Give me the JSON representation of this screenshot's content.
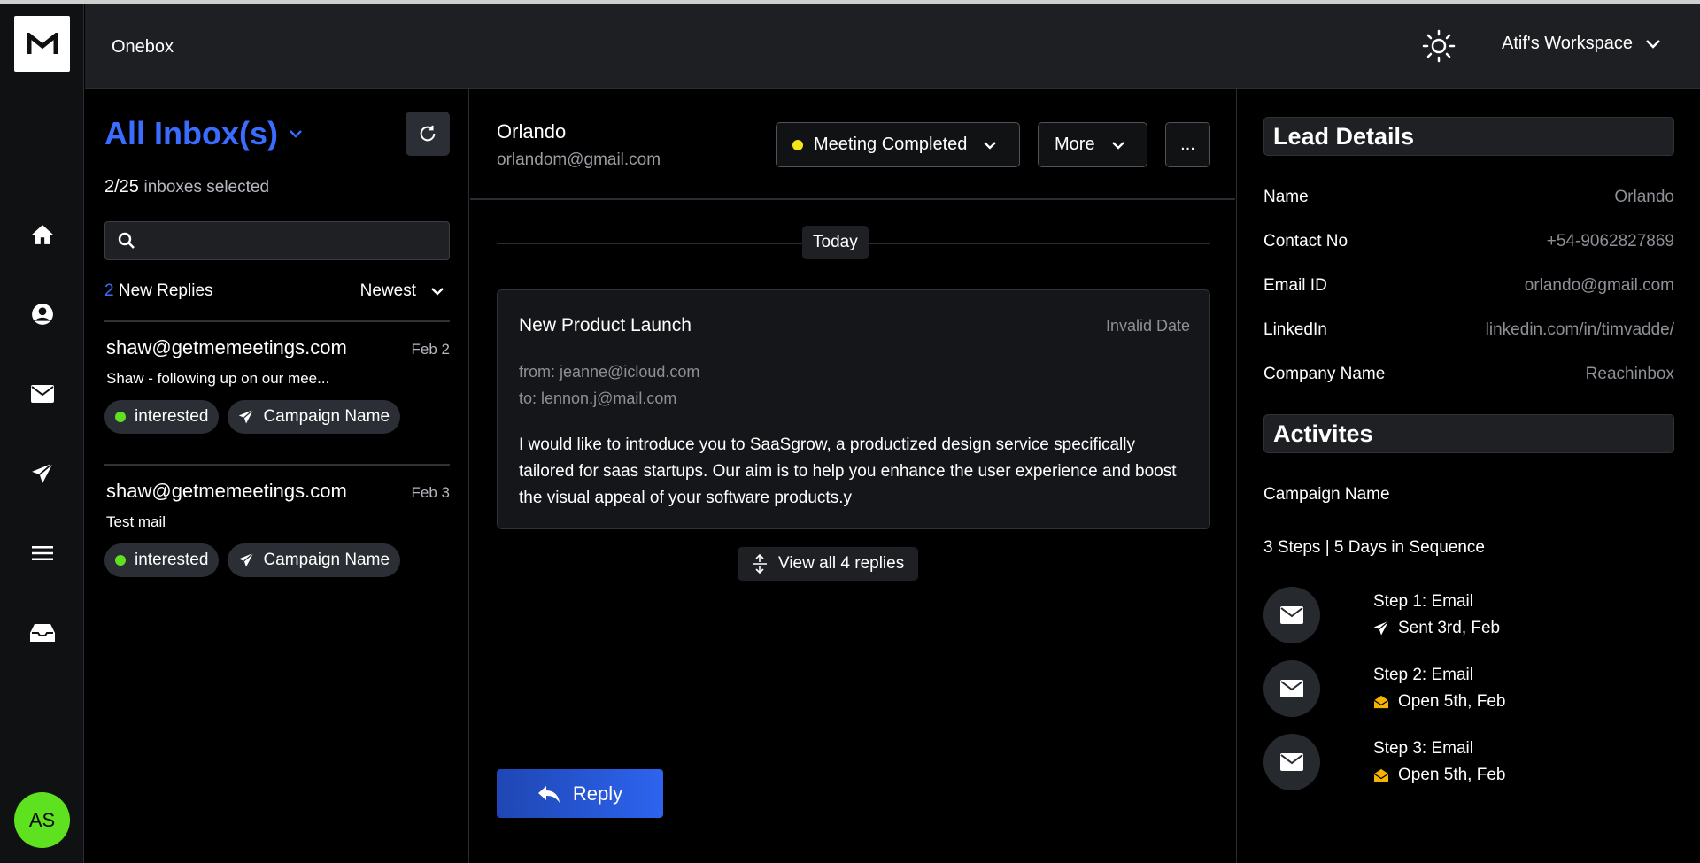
{
  "header": {
    "app_title": "Onebox",
    "workspace": "Atif's Workspace"
  },
  "rail": {
    "avatar_initials": "AS",
    "icons": [
      "home-icon",
      "profile-icon",
      "mail-icon",
      "send-icon",
      "list-icon",
      "inbox-tray-icon"
    ]
  },
  "inbox": {
    "title": "All Inbox(s)",
    "selected_count": "2/25",
    "selected_label": "inboxes selected",
    "search_placeholder": "",
    "new_replies_count": "2",
    "new_replies_label": "New Replies",
    "sort_label": "Newest",
    "threads": [
      {
        "email": "shaw@getmemeetings.com",
        "date": "Feb 2",
        "snippet": "Shaw - following up on our mee...",
        "status": "interested",
        "campaign": "Campaign Name"
      },
      {
        "email": "shaw@getmemeetings.com",
        "date": "Feb 3",
        "snippet": "Test mail",
        "status": "interested",
        "campaign": "Campaign Name"
      }
    ]
  },
  "conversation": {
    "lead_name": "Orlando",
    "lead_email": "orlandom@gmail.com",
    "status_button": "Meeting Completed",
    "more_button": "More",
    "ellipsis_button": "...",
    "day_label": "Today",
    "message": {
      "subject": "New Product Launch",
      "date": "Invalid Date",
      "from": "from: jeanne@icloud.com",
      "to": "to: lennon.j@mail.com",
      "body": "I would like to introduce you to SaaSgrow, a productized design service specifically tailored for saas startups. Our aim is to help you enhance the user experience and boost the visual appeal of your software products.y"
    },
    "view_all_label": "View all 4 replies",
    "reply_label": "Reply"
  },
  "lead_details": {
    "title": "Lead Details",
    "rows": [
      {
        "label": "Name",
        "value": "Orlando"
      },
      {
        "label": "Contact No",
        "value": "+54-9062827869"
      },
      {
        "label": "Email ID",
        "value": "orlando@gmail.com"
      },
      {
        "label": "LinkedIn",
        "value": "linkedin.com/in/timvadde/"
      },
      {
        "label": "Company Name",
        "value": "Reachinbox"
      }
    ]
  },
  "activities": {
    "title": "Activites",
    "campaign": "Campaign Name",
    "sequence": "3 Steps | 5 Days in Sequence",
    "steps": [
      {
        "title": "Step 1: Email",
        "status": "Sent 3rd, Feb",
        "icon": "send-icon"
      },
      {
        "title": "Step 2: Email",
        "status": "Open 5th, Feb",
        "icon": "open-mail-icon"
      },
      {
        "title": "Step 3: Email",
        "status": "Open 5th, Feb",
        "icon": "open-mail-icon"
      }
    ]
  },
  "colors": {
    "accent_blue": "#3a6dff",
    "interested_green": "#5ee21f",
    "meeting_yellow": "#f2e616",
    "open_icon_gold": "#f5b400"
  }
}
